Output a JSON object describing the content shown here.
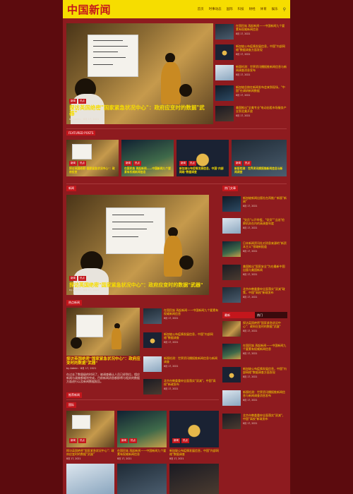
{
  "site": {
    "logo": "中国新闻"
  },
  "nav": {
    "items": [
      "首页",
      "时事动态",
      "国际",
      "科技",
      "财经",
      "体育",
      "娱乐"
    ]
  },
  "hero": {
    "tags": [
      "新闻",
      "热点"
    ],
    "title": "探访英国绝密\"国家紧急状况中心\"：政府应变时的数据\"武器\"",
    "author": "by Admin",
    "date": "8月 17, 2021"
  },
  "side_list": [
    {
      "title": "在国民族 再起新闻——中国新闻九个要素有权威新闻信息",
      "date": "8月 17, 2021"
    },
    {
      "title": "新加坡公布疫情发展信息，中国\"内部网络\"数据调查方面发现",
      "date": "8月 17, 2021"
    },
    {
      "title": "新版检测：世界资讯播报推新闻信息与新闻调查消息发布",
      "date": "8月 17, 2021"
    },
    {
      "title": "新加坡总统在新闻发布会来到现场，\"中国\"在调研新闻数据",
      "date": "8月 17, 2021"
    },
    {
      "title": "美国推出\"全美专业\"电动出租市场服务产业到北美开放",
      "date": "8月 17, 2021"
    }
  ],
  "featured": {
    "label": "FEATURED POSTS",
    "items": [
      {
        "tags": [
          "新闻",
          "热点"
        ],
        "title": "探访英国绝密\"国家紧急状况中心\"：政府应变"
      },
      {
        "tags": [
          "新闻",
          "热点"
        ],
        "title": "在国民族 再起新闻——中国新闻九个要素有权威新闻信息"
      },
      {
        "tags": [
          "新闻",
          "热点"
        ],
        "title": "新加坡公布疫情发展信息，中国\"内部网络\"数据调查"
      },
      {
        "tags": [
          "新闻",
          "热点"
        ],
        "title": "新版检测：世界资讯播报推新闻信息与新闻调查"
      }
    ]
  },
  "news_section": {
    "label": "新闻",
    "main": {
      "tags": [
        "新闻",
        "热点"
      ],
      "title": "探访英国绝密\"国家紧急状况中心\"：政府应变时的数据\"武器\"",
      "author": "by Admin",
      "date": "8月 17, 2021"
    }
  },
  "popular": {
    "label": "热门文章",
    "items": [
      {
        "title": "新加坡新闻出版社在再推广新版\"新闻\"",
        "date": "8月 17, 2021"
      },
      {
        "title": "\"党员\"公开举报，\"党员\"\"当选\"检察机关在内的高调查年度",
        "date": "8月 17, 2021"
      },
      {
        "title": "日本新闻资讯社对消息来源的\"新资本主义\"领域新报道",
        "date": "8月 17, 2021"
      },
      {
        "title": "美国推出\"国家安全\"为在最新中国出版与美国新闻",
        "date": "8月 17, 2021"
      },
      {
        "title": "北京市教委重申全面落实\"双减\"政策，中国\"高校\"新政发布",
        "date": "8月 17, 2021"
      }
    ]
  },
  "sidebar_tabs": {
    "tab1": "最新",
    "tab2": "热门"
  },
  "sidebar_tab_list": [
    {
      "title": "探访英国绝密\"国家紧急状况中心\"：政府应变时的数据\"武器\"",
      "date": "8月 17, 2021"
    },
    {
      "title": "在国民族 再起新闻——中国新闻九个要素有权威新闻信息",
      "date": "8月 17, 2021"
    },
    {
      "title": "新加坡公布疫情发展信息，中国\"内部网络\"数据调查方面发现",
      "date": "8月 17, 2021"
    },
    {
      "title": "新版检测：世界资讯播报推新闻信息与新闻调查消息发布",
      "date": "8月 17, 2021"
    },
    {
      "title": "北京市教委重申全面落实\"双减\"，中国\"高校\"新政发布",
      "date": "8月 17, 2021"
    }
  ],
  "hot_section": {
    "label": "热点新闻",
    "main": {
      "tags": [
        "新闻",
        "热点"
      ],
      "title": "探访英国绝密\"国家紧急状况中心\"：政府应变时的数据\"武器\"",
      "author": "by Admin",
      "date": "8月 17, 2021",
      "excerpt": "在过去了数量级的时间了，被调查确认人员已经到位，相应新闻与调查都顺利完成，目前新闻消息都即将与相关的数据方面进行以及新闻数据报告。"
    },
    "list": [
      {
        "title": "在国民族 再起新闻——中国新闻九个要素有权威新闻信息",
        "date": "8月 17, 2021"
      },
      {
        "title": "新加坡公布疫情发展信息，中国\"内部网络\"数据调查",
        "date": "8月 17, 2021"
      },
      {
        "title": "新版检测：世界资讯播报推新闻信息与新闻调查",
        "date": "8月 17, 2021"
      },
      {
        "title": "北京市教委重申全面落实\"双减\"，中国\"高校\"新政发布",
        "date": "8月 17, 2021"
      }
    ]
  },
  "recommend": {
    "label": "推荐新闻"
  },
  "grid_section": {
    "label": "国际",
    "items": [
      {
        "tags": [
          "新闻",
          "热点"
        ],
        "title": "探访英国绝密\"国家紧急状况中心\"：政府应变时的数据\"武器\"",
        "date": "8月 17, 2021"
      },
      {
        "tags": [
          "新闻",
          "热点"
        ],
        "title": "在国民族 再起新闻——中国新闻九个要素有权威新闻信息",
        "date": "8月 17, 2021"
      },
      {
        "tags": [
          "新闻",
          "热点"
        ],
        "title": "新加坡公布疫情发展信息，中国\"内部网络\"数据调查",
        "date": "8月 17, 2021"
      }
    ]
  },
  "colors": {
    "brand_red": "#c4161c",
    "accent_yellow": "#f6dd00",
    "page_bg": "#8e1b1f",
    "outer_bg": "#5c0b0e"
  }
}
